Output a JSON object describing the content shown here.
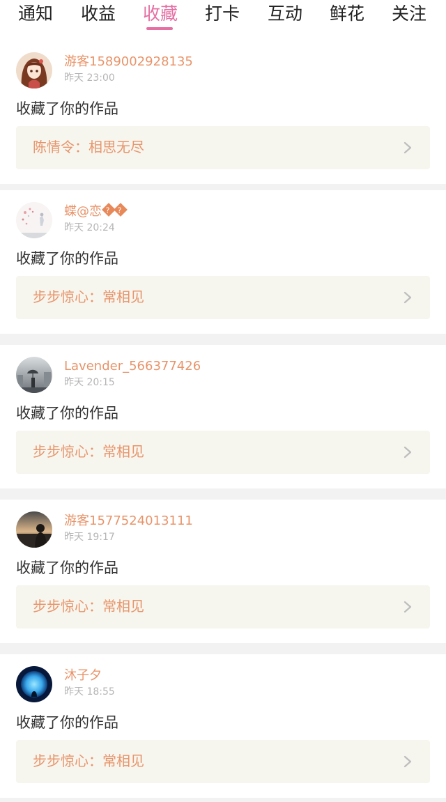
{
  "tabs": [
    {
      "label": "通知",
      "active": false
    },
    {
      "label": "收益",
      "active": false
    },
    {
      "label": "收藏",
      "active": true
    },
    {
      "label": "打卡",
      "active": false
    },
    {
      "label": "互动",
      "active": false
    },
    {
      "label": "鲜花",
      "active": false
    },
    {
      "label": "关注",
      "active": false
    }
  ],
  "accent_color": "#e56fa3",
  "name_color": "#e8946a",
  "feed": [
    {
      "username": "游客1589002928135",
      "time": "昨天 23:00",
      "action": "收藏了你的作品",
      "work": "陈情令：相思无尽",
      "avatar": "anime-girl-avatar"
    },
    {
      "username": "蝶@恋",
      "badges": [
        "?",
        "?"
      ],
      "time": "昨天 20:24",
      "action": "收藏了你的作品",
      "work": "步步惊心：常相见",
      "avatar": "floral-avatar"
    },
    {
      "username": "Lavender_566377426",
      "time": "昨天 20:15",
      "action": "收藏了你的作品",
      "work": "步步惊心：常相见",
      "avatar": "umbrella-city-avatar"
    },
    {
      "username": "游客1577524013111",
      "time": "昨天 19:17",
      "action": "收藏了你的作品",
      "work": "步步惊心：常相见",
      "avatar": "sunset-silhouette-avatar"
    },
    {
      "username": "沐子夕",
      "time": "昨天 18:55",
      "action": "收藏了你的作品",
      "work": "步步惊心：常相见",
      "avatar": "blue-moon-avatar"
    }
  ]
}
